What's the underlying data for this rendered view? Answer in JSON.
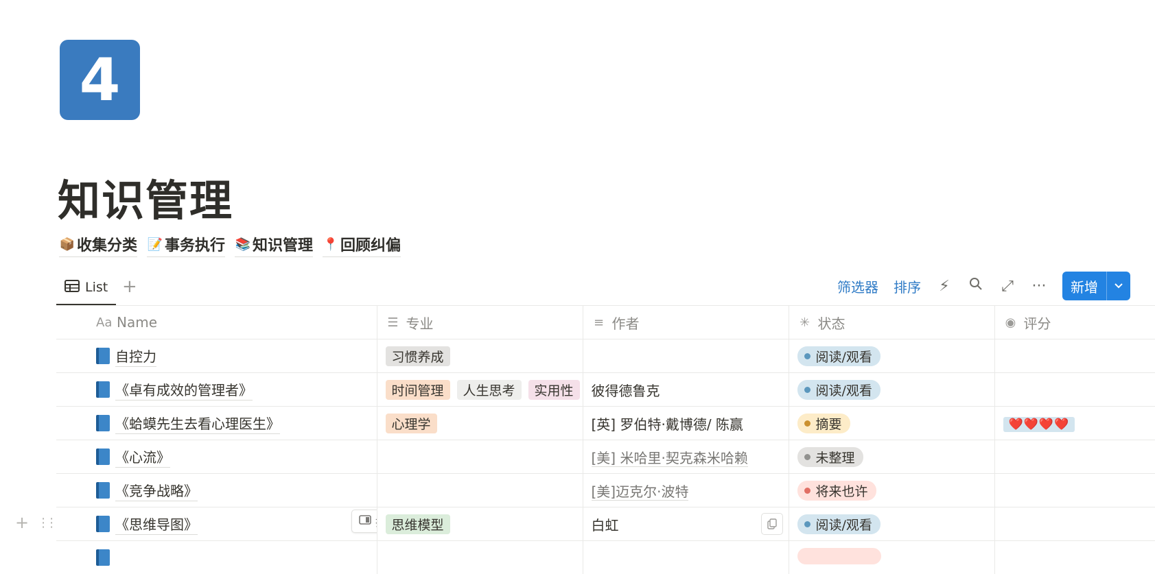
{
  "page": {
    "icon_text": "4",
    "title": "知识管理",
    "quick_links": [
      {
        "emoji": "📦",
        "label": "收集分类"
      },
      {
        "emoji": "📝",
        "label": "事务执行"
      },
      {
        "emoji": "📚",
        "label": "知识管理"
      },
      {
        "emoji": "📍",
        "label": "回顾纠偏"
      }
    ]
  },
  "view": {
    "tab_label": "List",
    "tab_icon": "table-icon",
    "add_view": "+"
  },
  "toolbar": {
    "filter_label": "筛选器",
    "sort_label": "排序",
    "automation_icon": "⚡",
    "search_icon": "⌕",
    "expand_icon": "⤢",
    "more_icon": "···",
    "new_label": "新增",
    "new_dropdown_icon": "chevron-down-icon",
    "accent": "#2383e2"
  },
  "columns": [
    {
      "icon": "Aa",
      "label": "Name"
    },
    {
      "icon": "☰",
      "label": "专业"
    },
    {
      "icon": "≡",
      "label": "作者"
    },
    {
      "icon": "✳",
      "label": "状态"
    },
    {
      "icon": "◉",
      "label": "评分"
    }
  ],
  "rows": [
    {
      "name": "自控力",
      "tags": [
        {
          "label": "习惯养成",
          "color": "gray"
        }
      ],
      "author": "",
      "status": {
        "label": "阅读/观看",
        "color": "blue"
      },
      "rating": ""
    },
    {
      "name": "《卓有成效的管理者》",
      "tags": [
        {
          "label": "时间管理",
          "color": "peach"
        },
        {
          "label": "人生思考",
          "color": "light"
        },
        {
          "label": "实用性",
          "color": "pink"
        }
      ],
      "author": "彼得德鲁克",
      "status": {
        "label": "阅读/观看",
        "color": "blue"
      },
      "rating": ""
    },
    {
      "name": "《蛤蟆先生去看心理医生》",
      "tags": [
        {
          "label": "心理学",
          "color": "peach"
        }
      ],
      "author": "[英] 罗伯特·戴博德/ 陈赢",
      "status": {
        "label": "摘要",
        "color": "yellow"
      },
      "rating": "❤️❤️❤️❤️"
    },
    {
      "name": "《心流》",
      "tags": [],
      "author": "[美] 米哈里·契克森米哈赖",
      "author_link": true,
      "status": {
        "label": "未整理",
        "color": "gray"
      },
      "rating": ""
    },
    {
      "name": "《竞争战略》",
      "tags": [],
      "author": "[美]迈克尔·波特",
      "author_link": true,
      "status": {
        "label": "将来也许",
        "color": "red"
      },
      "rating": ""
    },
    {
      "name": "《思维导图》",
      "tags": [
        {
          "label": "思维模型",
          "color": "green"
        }
      ],
      "author": "白虹",
      "status": {
        "label": "阅读/观看",
        "color": "blue"
      },
      "rating": "",
      "hover": true
    }
  ],
  "row_actions": {
    "open_label": "打开",
    "add_icon": "+",
    "drag_icon": "⋮⋮"
  }
}
